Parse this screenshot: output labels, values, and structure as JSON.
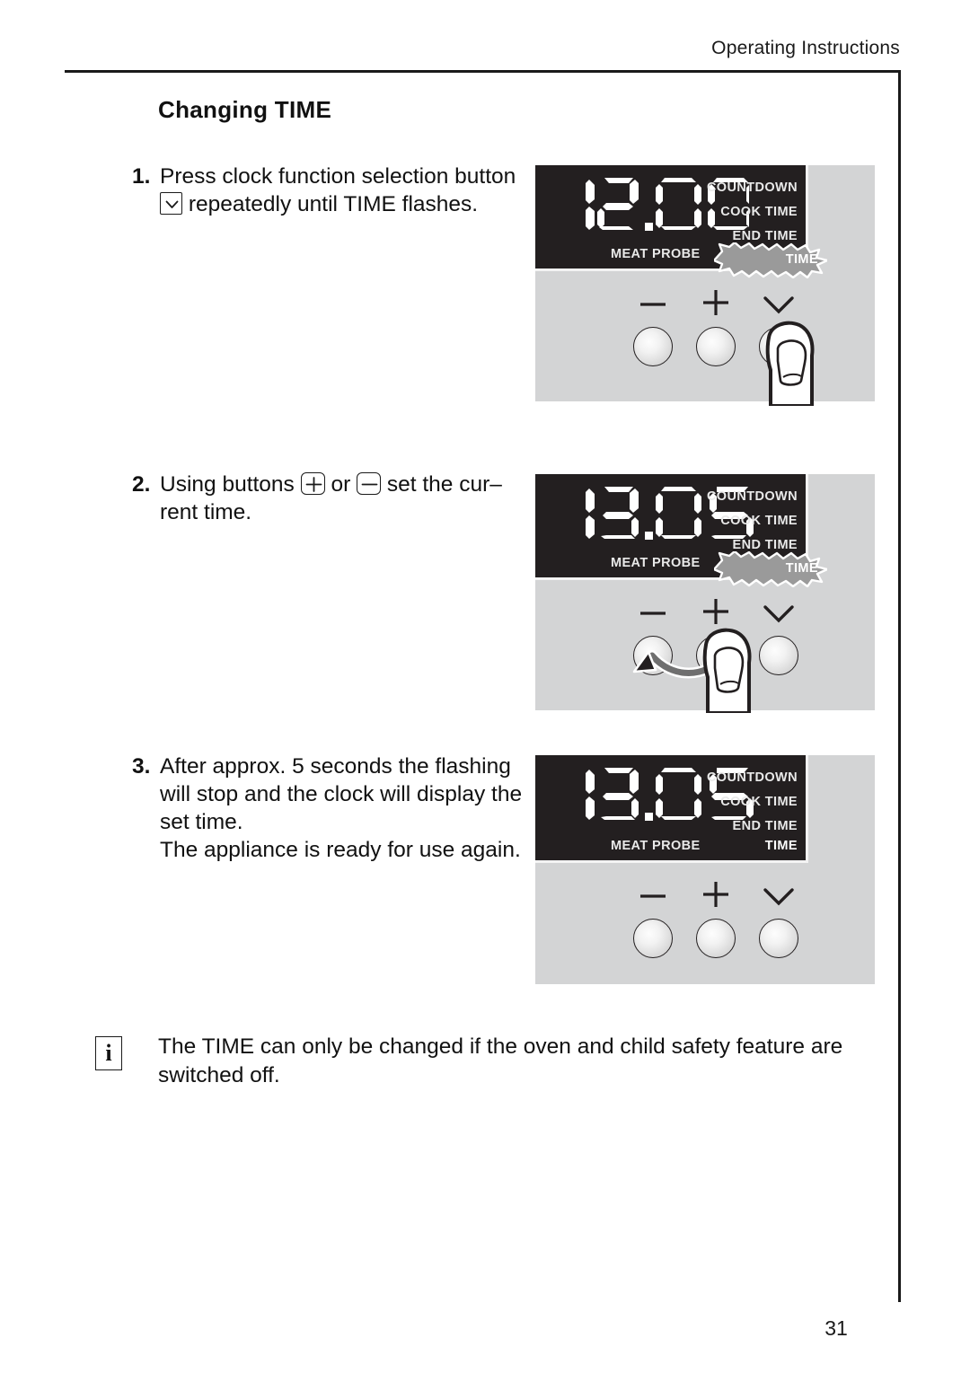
{
  "header": {
    "title": "Operating Instructions"
  },
  "page_number": "31",
  "section": {
    "title": "Changing TIME"
  },
  "steps": [
    {
      "number": "1.",
      "text_before": "Press clock function selection button",
      "icon": "chevron-down-icon",
      "text_after": "repeatedly until TIME flashes."
    },
    {
      "number": "2.",
      "text_before": "Using buttons",
      "icon_plus": "plus-icon",
      "text_middle": "or",
      "icon_minus": "minus-icon",
      "text_after": "set the cur– rent time."
    },
    {
      "number": "3.",
      "line_1": "After approx. 5 seconds the flashing will stop and the clock will display the set time.",
      "line_2": "The appliance is ready for use again."
    }
  ],
  "note": {
    "icon": "info-icon",
    "icon_glyph": "i",
    "text": "The TIME can only be changed if the oven and child safety feature are switched off."
  },
  "figures": [
    {
      "name": "figure-step-1",
      "display_value": "12.00",
      "mode_labels": [
        "COUNTDOWN",
        "COOK TIME",
        "END TIME"
      ],
      "label_meat_probe": "MEAT PROBE",
      "label_time": "TIME",
      "time_flashing": true,
      "buttons": [
        {
          "name": "minus-button",
          "symbol": "minus"
        },
        {
          "name": "plus-button",
          "symbol": "plus"
        },
        {
          "name": "clock-function-button",
          "symbol": "chevron-down"
        }
      ],
      "finger_on": "clock-function-button",
      "arrow": false
    },
    {
      "name": "figure-step-2",
      "display_value": "13.05",
      "mode_labels": [
        "COUNTDOWN",
        "COOK TIME",
        "END TIME"
      ],
      "label_meat_probe": "MEAT PROBE",
      "label_time": "TIME",
      "time_flashing": true,
      "buttons": [
        {
          "name": "minus-button",
          "symbol": "minus"
        },
        {
          "name": "plus-button",
          "symbol": "plus"
        },
        {
          "name": "clock-function-button",
          "symbol": "chevron-down"
        }
      ],
      "finger_on": "plus-button",
      "arrow": true
    },
    {
      "name": "figure-step-3",
      "display_value": "13.05",
      "mode_labels": [
        "COUNTDOWN",
        "COOK TIME",
        "END TIME"
      ],
      "label_meat_probe": "MEAT PROBE",
      "label_time": "TIME",
      "time_flashing": false,
      "buttons": [
        {
          "name": "minus-button",
          "symbol": "minus"
        },
        {
          "name": "plus-button",
          "symbol": "plus"
        },
        {
          "name": "clock-function-button",
          "symbol": "chevron-down"
        }
      ],
      "finger_on": null,
      "arrow": false
    }
  ],
  "colors": {
    "display_background": "#231f20",
    "panel_background": "#d3d4d5",
    "display_text": "#ffffff",
    "flash_fill": "#9a9a9a",
    "ink": "#1a1a1a"
  }
}
